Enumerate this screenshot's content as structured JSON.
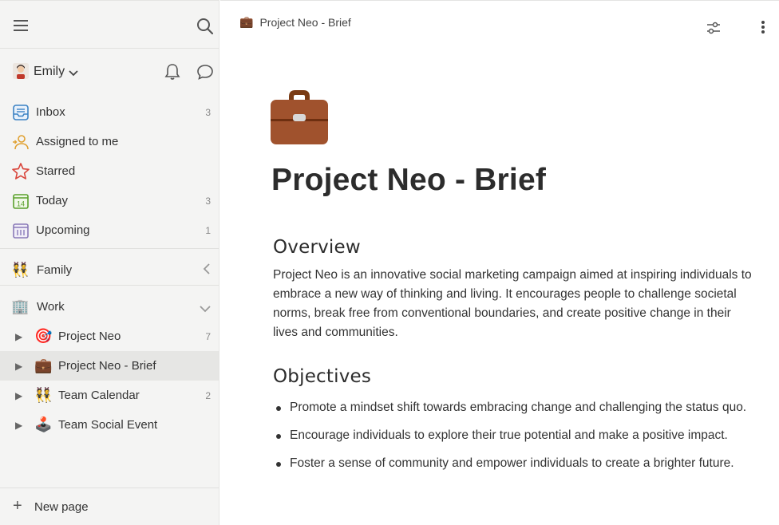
{
  "sidebar": {
    "user": {
      "name": "Emily"
    },
    "nav": [
      {
        "label": "Inbox",
        "count": "3"
      },
      {
        "label": "Assigned to me",
        "count": ""
      },
      {
        "label": "Starred",
        "count": ""
      },
      {
        "label": "Today",
        "count": "3",
        "icon_text": "14"
      },
      {
        "label": "Upcoming",
        "count": "1"
      }
    ],
    "sections": [
      {
        "label": "Family",
        "emoji": "👯"
      },
      {
        "label": "Work",
        "emoji": "🏢"
      }
    ],
    "pages": [
      {
        "label": "Project Neo",
        "emoji": "🎯",
        "count": "7"
      },
      {
        "label": "Project Neo - Brief",
        "emoji": "💼",
        "count": ""
      },
      {
        "label": "Team Calendar",
        "emoji": "👯",
        "count": "2"
      },
      {
        "label": "Team Social Event",
        "emoji": "🕹️",
        "count": ""
      }
    ],
    "new_page_label": "New page"
  },
  "main": {
    "breadcrumb": {
      "emoji": "💼",
      "label": "Project Neo - Brief"
    },
    "title": "Project Neo - Brief",
    "overview_heading": "Overview",
    "overview_text": "Project Neo is an innovative social marketing campaign aimed at inspiring individuals to embrace a new way of thinking and living. It encourages people to challenge societal norms, break free from conventional boundaries, and create positive change in their lives and communities.",
    "objectives_heading": "Objectives",
    "objectives": [
      "Promote a mindset shift towards embracing change and challenging the status quo.",
      "Encourage individuals to explore their true potential and make a positive impact.",
      "Foster a sense of community and empower individuals to create a brighter future."
    ]
  },
  "colors": {
    "accent_briefcase": "#a0522d",
    "sidebar_bg": "#f4f4f3",
    "active_item_bg": "#e6e6e4"
  }
}
